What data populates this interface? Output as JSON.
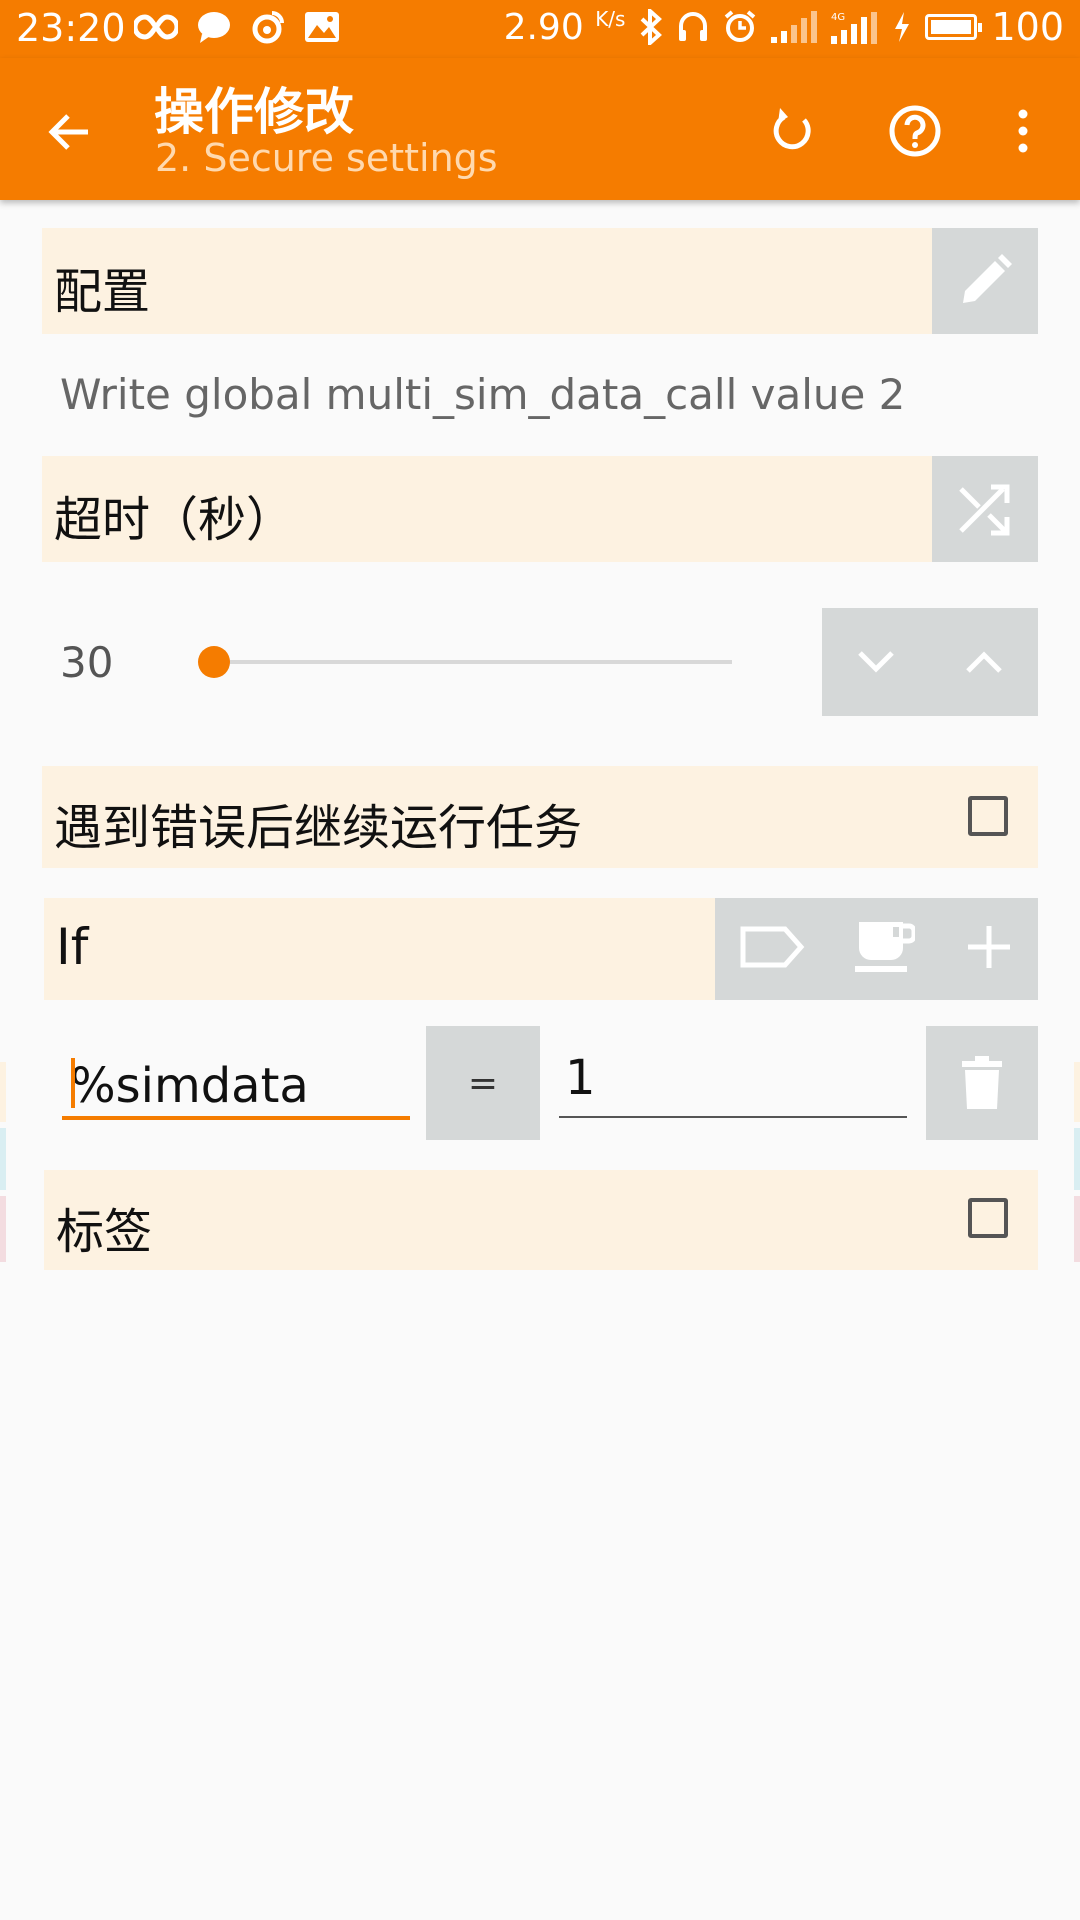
{
  "status_bar": {
    "time": "23:20",
    "speed_value": "2.90",
    "speed_unit": "K/s",
    "battery": "100"
  },
  "toolbar": {
    "title": "操作修改",
    "subtitle": "2. Secure settings"
  },
  "config_section": {
    "label": "配置",
    "description": "Write global multi_sim_data_call value 2"
  },
  "timeout_section": {
    "label": "超时（秒）",
    "value": "30",
    "slider_fraction": 0.0
  },
  "continue_on_error": {
    "label": "遇到错误后继续运行任务",
    "checked": false
  },
  "if_section": {
    "label": "If",
    "condition": {
      "left": "%simdata",
      "operator": "=",
      "right": "1"
    }
  },
  "label_section": {
    "label": "标签",
    "checked": false
  },
  "colors": {
    "accent": "#f57c00",
    "section_bg": "#fdf2e1",
    "button_bg": "#d5d8d8",
    "page_bg": "#fafafa"
  }
}
